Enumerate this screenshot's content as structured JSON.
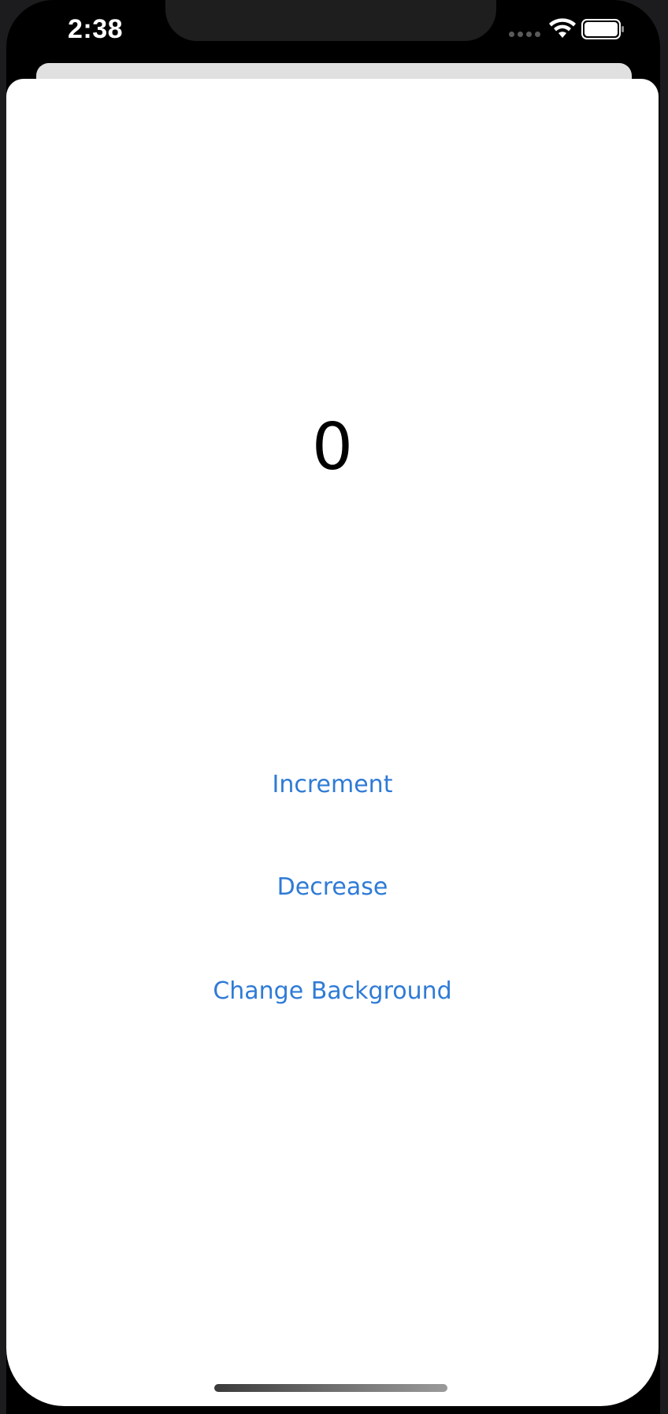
{
  "status_bar": {
    "time": "2:38"
  },
  "counter": {
    "value": "0"
  },
  "buttons": {
    "increment": "Increment",
    "decrease": "Decrease",
    "change_background": "Change Background"
  },
  "colors": {
    "accent": "#2f7bd6",
    "sheet_background": "#ffffff",
    "frame": "#000000"
  },
  "icons": [
    "signal-icon",
    "wifi-icon",
    "battery-icon"
  ]
}
